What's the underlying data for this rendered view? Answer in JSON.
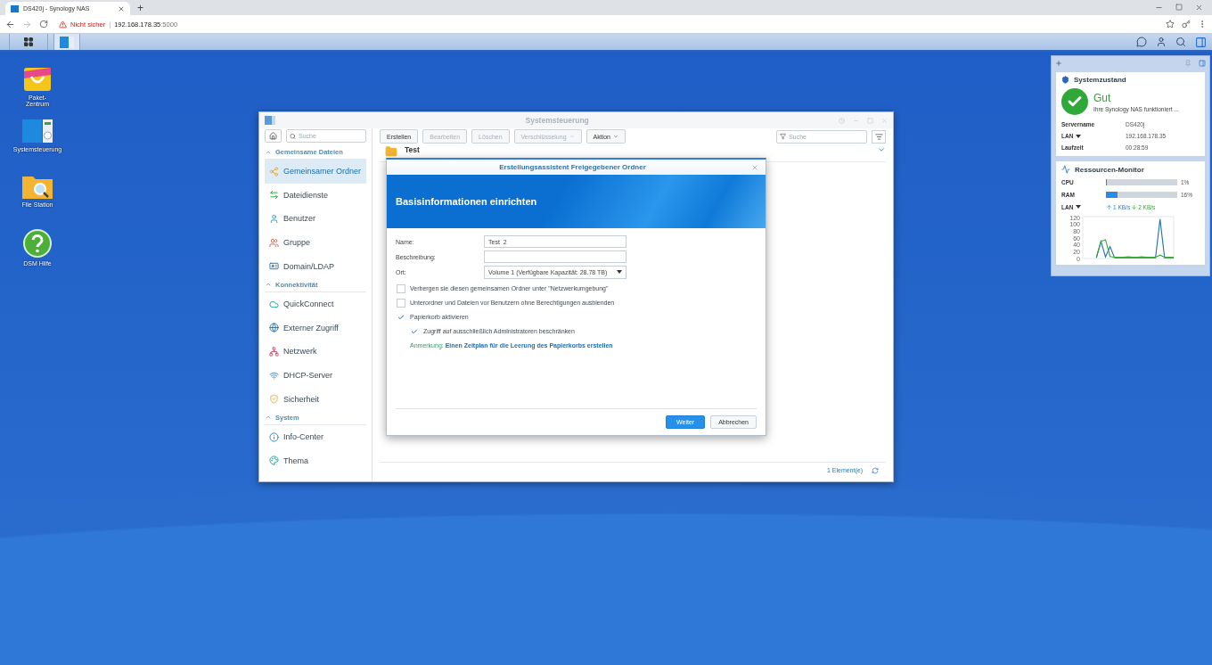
{
  "browser": {
    "tab_title": "DS420j - Synology NAS",
    "new_tab": "+",
    "warning": "Nicht sicher",
    "separator": "|",
    "host": "192.168.178.35",
    "port": ":5000"
  },
  "desktop_icons": [
    {
      "label": "Paket-Zentrum",
      "kind": "package"
    },
    {
      "label": "Systemsteuerung",
      "kind": "control"
    },
    {
      "label": "File Station",
      "kind": "folder"
    },
    {
      "label": "DSM Hilfe",
      "kind": "help"
    }
  ],
  "control_panel": {
    "title": "Systemsteuerung",
    "search_placeholder": "Suche",
    "sections": [
      {
        "title": "Gemeinsame Dateien",
        "items": [
          {
            "label": "Gemeinsamer Ordner",
            "kind": "share",
            "selected": true
          },
          {
            "label": "Dateidienste",
            "kind": "services",
            "selected": false
          },
          {
            "label": "Benutzer",
            "kind": "user",
            "selected": false
          },
          {
            "label": "Gruppe",
            "kind": "group",
            "selected": false
          },
          {
            "label": "Domain/LDAP",
            "kind": "domain",
            "selected": false
          }
        ]
      },
      {
        "title": "Konnektivität",
        "items": [
          {
            "label": "QuickConnect",
            "kind": "cloud",
            "selected": false
          },
          {
            "label": "Externer Zugriff",
            "kind": "globe",
            "selected": false
          },
          {
            "label": "Netzwerk",
            "kind": "network",
            "selected": false
          },
          {
            "label": "DHCP-Server",
            "kind": "dhcp",
            "selected": false
          },
          {
            "label": "Sicherheit",
            "kind": "shield",
            "selected": false
          }
        ]
      },
      {
        "title": "System",
        "items": [
          {
            "label": "Info-Center",
            "kind": "info",
            "selected": false
          },
          {
            "label": "Thema",
            "kind": "palette",
            "selected": false
          }
        ]
      }
    ],
    "toolbar": [
      {
        "label": "Erstellen",
        "disabled": false,
        "dropdown": false
      },
      {
        "label": "Bearbeiten",
        "disabled": true,
        "dropdown": false
      },
      {
        "label": "Löschen",
        "disabled": true,
        "dropdown": false
      },
      {
        "label": "Verschlüsselung",
        "disabled": true,
        "dropdown": true
      },
      {
        "label": "Aktion",
        "disabled": false,
        "dropdown": true
      }
    ],
    "filter_placeholder": "Suche",
    "rows": [
      {
        "name": "Test"
      }
    ],
    "footer_count": "1 Element(e)"
  },
  "dialog": {
    "title": "Erstellungsassistent Freigegebener Ordner",
    "header": "Basisinformationen einrichten",
    "fields": [
      {
        "label": "Name:",
        "value": "Test_2",
        "kind": "text"
      },
      {
        "label": "Beschreibung:",
        "kind": "text"
      },
      {
        "label": "Ort:",
        "value": "Volume 1 (Verfügbare Kapazität: 28.78 TB)",
        "kind": "select"
      }
    ],
    "options": [
      {
        "label": "Verbergen sie diesen gemeinsamen Ordner unter \"Netzwerkumgebung\"",
        "checked": false
      },
      {
        "label": "Unterordner und Dateien vor Benutzern ohne Berechtigungen ausblenden",
        "checked": false
      },
      {
        "label": "Papierkorb aktivieren",
        "checked": true,
        "children": [
          {
            "label": "Zugriff auf ausschließlich Administratoren beschränken",
            "checked": true
          }
        ]
      }
    ],
    "note": {
      "label": "Anmerkung:",
      "link": "Einen Zeitplan für die Leerung des Papierkorbs erstellen"
    },
    "buttons": [
      {
        "label": "Weiter",
        "primary": true
      },
      {
        "label": "Abbrechen",
        "primary": false
      }
    ]
  },
  "widgets": {
    "status": {
      "title": "Systemzustand",
      "state": "Gut",
      "message": "Ihre Synology NAS funktioniert ...",
      "rows": [
        {
          "label": "Servername",
          "dropdown": false,
          "value": "DS420j"
        },
        {
          "label": "LAN",
          "dropdown": true,
          "value": "192.168.178.35"
        },
        {
          "label": "Laufzeit",
          "dropdown": false,
          "value": "00:28:59"
        }
      ]
    },
    "resources": {
      "title": "Ressourcen-Monitor",
      "meters": [
        {
          "label": "CPU",
          "level": 0.01,
          "reading": "1%"
        },
        {
          "label": "RAM",
          "level": 0.16,
          "reading": "16%"
        }
      ],
      "lan": {
        "label": "LAN",
        "up": "1 KB/s",
        "down": "2 KB/s"
      },
      "chart_data": {
        "type": "line",
        "ylim": [
          0,
          120
        ],
        "yticks": [
          0,
          20,
          40,
          60,
          80,
          100,
          120
        ],
        "series": [
          {
            "color": "#1f6fb5",
            "values": [
              null,
              null,
              null,
              2,
              50,
              5,
              35,
              2,
              2,
              2,
              3,
              2,
              2,
              3,
              2,
              2,
              2,
              115,
              2,
              2,
              2
            ]
          },
          {
            "color": "#3aa53a",
            "values": [
              null,
              null,
              null,
              4,
              50,
              55,
              6,
              4,
              4,
              4,
              5,
              4,
              4,
              5,
              4,
              4,
              4,
              10,
              4,
              4,
              4
            ]
          }
        ]
      }
    }
  }
}
